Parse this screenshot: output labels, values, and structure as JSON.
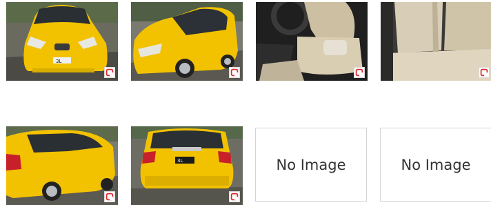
{
  "gallery": {
    "photos": [
      {
        "name": "front-view-photo",
        "plate": "3L"
      },
      {
        "name": "front-side-view-photo",
        "plate": ""
      },
      {
        "name": "driver-seat-interior-photo",
        "plate": ""
      },
      {
        "name": "rear-seat-interior-photo",
        "plate": ""
      },
      {
        "name": "rear-side-view-photo",
        "plate": ""
      },
      {
        "name": "rear-view-photo",
        "plate": "3L"
      }
    ],
    "badge_icon": "gallery-badge-icon",
    "placeholders": [
      {
        "label": "No Image"
      },
      {
        "label": "No Image"
      }
    ]
  },
  "colors": {
    "car_yellow": "#f2c200",
    "badge_red": "#d62b2b",
    "placeholder_border": "#d3d3d3"
  }
}
